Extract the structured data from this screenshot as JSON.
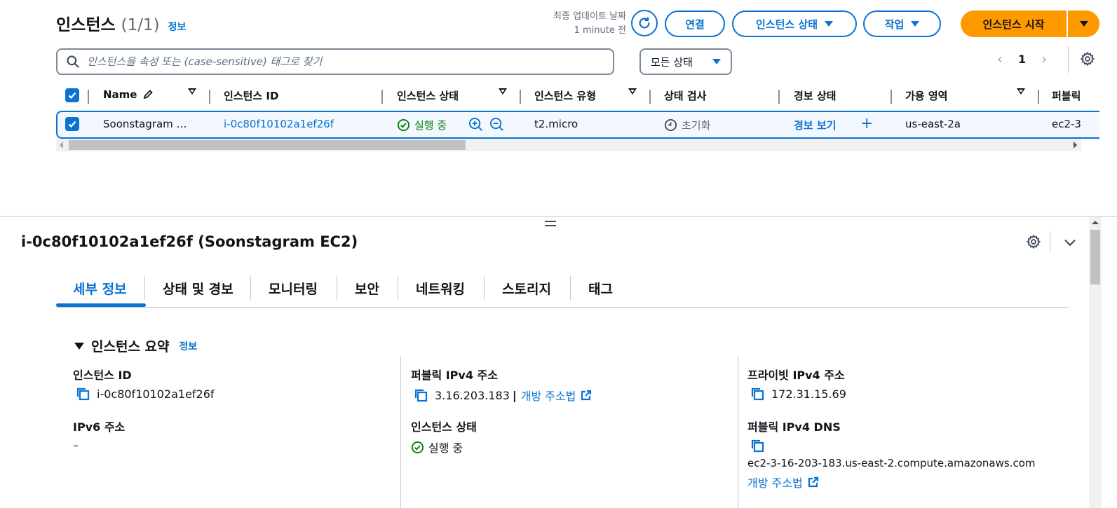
{
  "header": {
    "title": "인스턴스",
    "count": "(1/1)",
    "info_label": "정보",
    "last_update_label": "최종 업데이트 날짜",
    "last_update_value": "1 minute 전"
  },
  "toolbar": {
    "connect_label": "연결",
    "instance_state_label": "인스턴스 상태",
    "actions_label": "작업",
    "launch_label": "인스턴스 시작"
  },
  "filter": {
    "search_placeholder": "인스턴스을 속성 또는 (case-sensitive) 태그로 찾기",
    "state_select": "모든 상태"
  },
  "pagination": {
    "prev": "‹",
    "page": "1",
    "next": "›"
  },
  "table": {
    "columns": [
      "Name",
      "인스턴스 ID",
      "인스턴스 상태",
      "인스턴스 유형",
      "상태 검사",
      "경보 상태",
      "가용 영역",
      "퍼블릭"
    ],
    "row": {
      "name": "Soonstagram …",
      "instance_id": "i-0c80f10102a1ef26f",
      "state": "실행 중",
      "type": "t2.micro",
      "status_check": "초기화",
      "alarm": "경보 보기",
      "alarm_add": "+",
      "zone": "us-east-2a",
      "public": "ec2-3"
    }
  },
  "detail": {
    "title": "i-0c80f10102a1ef26f (Soonstagram EC2)",
    "tabs": [
      "세부 정보",
      "상태 및 경보",
      "모니터링",
      "보안",
      "네트워킹",
      "스토리지",
      "태그"
    ],
    "section_title": "인스턴스 요약",
    "section_info": "정보",
    "fields": {
      "instance_id_label": "인스턴스 ID",
      "instance_id_value": "i-0c80f10102a1ef26f",
      "public_ipv4_label": "퍼블릭 IPv4 주소",
      "public_ipv4_value": "3.16.203.183",
      "open_address_label": "개방 주소법",
      "private_ipv4_label": "프라이빗 IPv4 주소",
      "private_ipv4_value": "172.31.15.69",
      "ipv6_label": "IPv6 주소",
      "ipv6_value": "–",
      "instance_state_label": "인스턴스 상태",
      "instance_state_value": "실행 중",
      "public_dns_label": "퍼블릭 IPv4 DNS",
      "public_dns_value": "ec2-3-16-203-183.us-east-2.compute.amazonaws.com",
      "open_address_label_2": "개방 주소법"
    }
  },
  "colors": {
    "accent": "#0972d3",
    "primary": "#ff9900",
    "success": "#037f0c"
  }
}
